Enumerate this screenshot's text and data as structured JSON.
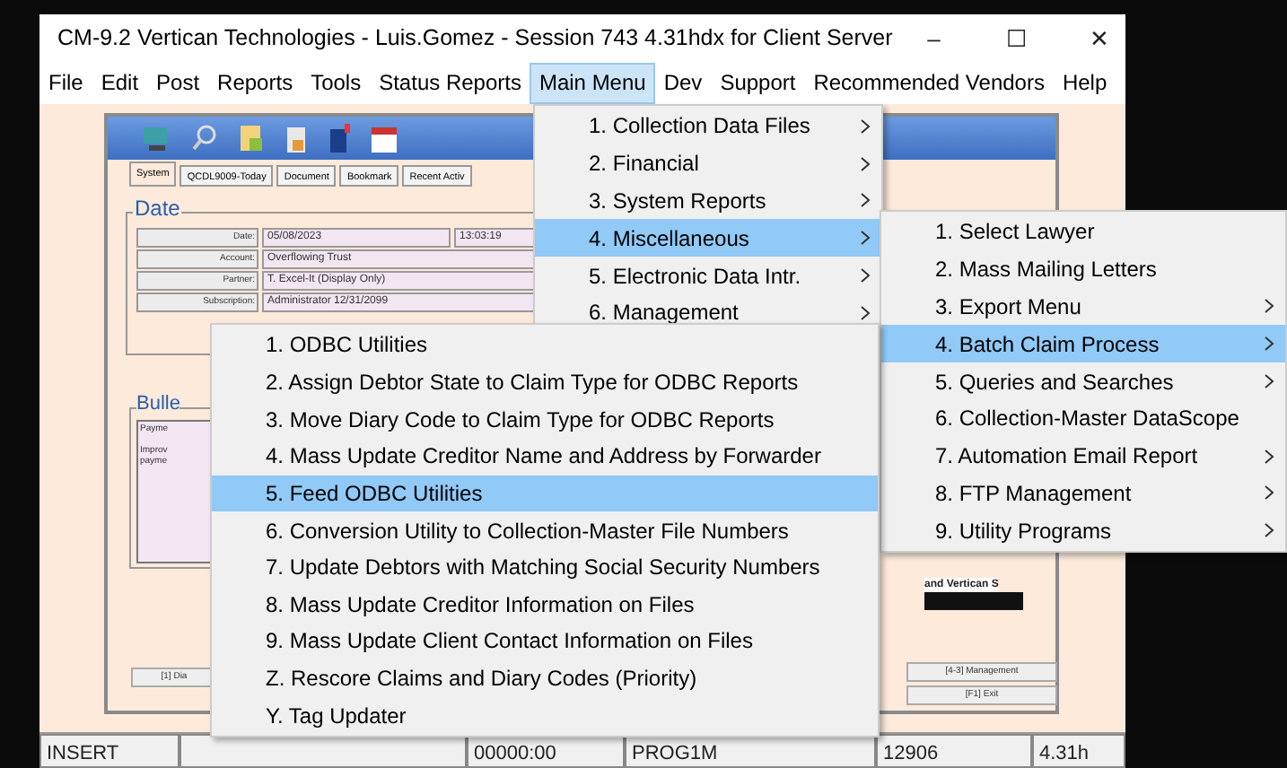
{
  "window": {
    "title": "CM-9.2 Vertican Technologies - Luis.Gomez - Session 743 4.31hdx for Client Server",
    "controls": [
      "–",
      "☐",
      "✕"
    ]
  },
  "menubar": [
    {
      "label": "File",
      "selected": false
    },
    {
      "label": "Edit",
      "selected": false
    },
    {
      "label": "Post",
      "selected": false
    },
    {
      "label": "Reports",
      "selected": false
    },
    {
      "label": "Tools",
      "selected": false
    },
    {
      "label": "Status Reports",
      "selected": false
    },
    {
      "label": "Main Menu",
      "selected": true
    },
    {
      "label": "Dev",
      "selected": false
    },
    {
      "label": "Support",
      "selected": false
    },
    {
      "label": "Recommended Vendors",
      "selected": false
    },
    {
      "label": "Help",
      "selected": false
    }
  ],
  "app": {
    "tabs": [
      {
        "label": "System",
        "selected": true
      },
      {
        "label": "QCDL9009-Today",
        "selected": false
      },
      {
        "label": "Document",
        "selected": false
      },
      {
        "label": "Bookmark",
        "selected": false
      },
      {
        "label": "Recent Activ",
        "selected": false
      }
    ],
    "date_group": {
      "title": "Date",
      "fields": [
        {
          "label": "Date:",
          "values": [
            "05/08/2023",
            "13:03:19"
          ]
        },
        {
          "label": "Account:",
          "values": [
            "Overflowing Trust"
          ]
        },
        {
          "label": "Partner:",
          "values": [
            "T. Excel-It (Display Only)"
          ]
        },
        {
          "label": "Subscription:",
          "values": [
            "Administrator 12/31/2099"
          ]
        }
      ]
    },
    "bulletin": {
      "title": "Bulle",
      "lines": [
        "Payme",
        "Improv",
        "payme"
      ]
    },
    "caption": "and Vertican S",
    "buttons": [
      {
        "label": "[1] Dia"
      },
      {
        "label": "[4-3] Management"
      },
      {
        "label": "[F1] Exit"
      }
    ]
  },
  "menus": [
    {
      "items": [
        {
          "label": "1. Collection Data Files",
          "selected": false,
          "submenu": true
        },
        {
          "label": "2. Financial",
          "selected": false,
          "submenu": true
        },
        {
          "label": "3. System Reports",
          "selected": false,
          "submenu": true
        },
        {
          "label": "4. Miscellaneous",
          "selected": true,
          "submenu": true
        },
        {
          "label": "5. Electronic Data Intr.",
          "selected": false,
          "submenu": true
        },
        {
          "label": "6. Management",
          "selected": false,
          "submenu": true
        }
      ]
    },
    {
      "items": [
        {
          "label": "1. Select Lawyer",
          "selected": false,
          "submenu": false
        },
        {
          "label": "2. Mass Mailing Letters",
          "selected": false,
          "submenu": false
        },
        {
          "label": "3. Export Menu",
          "selected": false,
          "submenu": true
        },
        {
          "label": "4. Batch Claim Process",
          "selected": true,
          "submenu": true
        },
        {
          "label": "5. Queries and Searches",
          "selected": false,
          "submenu": true
        },
        {
          "label": "6. Collection-Master DataScope",
          "selected": false,
          "submenu": false
        },
        {
          "label": "7. Automation Email Report",
          "selected": false,
          "submenu": true
        },
        {
          "label": "8. FTP Management",
          "selected": false,
          "submenu": true
        },
        {
          "label": "9. Utility Programs",
          "selected": false,
          "submenu": true
        }
      ]
    },
    {
      "items": [
        {
          "label": "1. ODBC Utilities",
          "selected": false,
          "submenu": false
        },
        {
          "label": "2. Assign Debtor State to Claim Type for ODBC Reports",
          "selected": false,
          "submenu": false
        },
        {
          "label": "3. Move Diary Code to Claim Type for ODBC Reports",
          "selected": false,
          "submenu": false
        },
        {
          "label": "4. Mass Update Creditor Name and Address by Forwarder",
          "selected": false,
          "submenu": false
        },
        {
          "label": "5. Feed ODBC Utilities",
          "selected": true,
          "submenu": false
        },
        {
          "label": "6. Conversion Utility to Collection-Master File Numbers",
          "selected": false,
          "submenu": false
        },
        {
          "label": "7. Update Debtors with Matching Social Security Numbers",
          "selected": false,
          "submenu": false
        },
        {
          "label": "8. Mass Update Creditor Information on Files",
          "selected": false,
          "submenu": false
        },
        {
          "label": "9. Mass Update Client Contact Information on Files",
          "selected": false,
          "submenu": false
        },
        {
          "label": "Z. Rescore Claims and Diary Codes (Priority)",
          "selected": false,
          "submenu": false
        },
        {
          "label": "Y. Tag Updater",
          "selected": false,
          "submenu": false
        }
      ]
    }
  ],
  "status_bar": [
    "INSERT",
    "00000:00",
    "PROG1M",
    "12906",
    "4.31h"
  ]
}
